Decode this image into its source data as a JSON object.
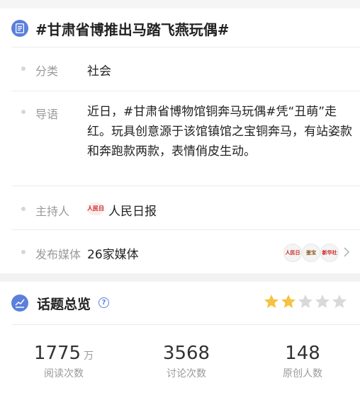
{
  "topic": {
    "title": "#甘肃省博推出马踏飞燕玩偶#"
  },
  "details": {
    "category_label": "分类",
    "category_value": "社会",
    "intro_label": "导语",
    "intro_text": "近日，#甘肃省博物馆铜奔马玩偶#凭“丑萌”走红。玩具创意源于该馆镇馆之宝铜奔马，有站姿款和奔跑款两款，表情俏皮生动。",
    "host_label": "主持人",
    "host_name": "人民日报",
    "host_logo_text": "人民日报",
    "media_label": "发布媒体",
    "media_value": "26家媒体",
    "media_logos": [
      "人民日报",
      "鉴宝",
      "新华社"
    ]
  },
  "overview": {
    "title": "话题总览",
    "rating": 2,
    "rating_max": 5,
    "colors": {
      "star_on": "#f5c242",
      "star_off": "#d9d9d9",
      "accent": "#5b7fdc"
    },
    "stats": [
      {
        "value": "1775",
        "unit": "万",
        "label": "阅读次数"
      },
      {
        "value": "3568",
        "unit": "",
        "label": "讨论次数"
      },
      {
        "value": "148",
        "unit": "",
        "label": "原创人数"
      }
    ]
  }
}
